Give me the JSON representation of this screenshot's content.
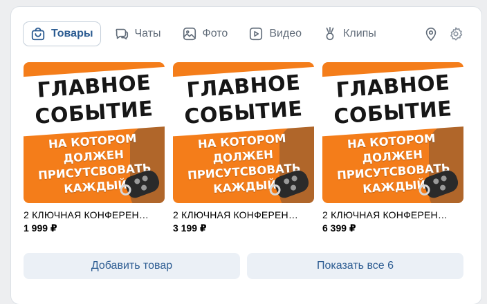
{
  "tabs": [
    {
      "label": "Товары",
      "icon": "bag-icon",
      "active": true
    },
    {
      "label": "Чаты",
      "icon": "chats-icon",
      "active": false
    },
    {
      "label": "Фото",
      "icon": "photo-icon",
      "active": false
    },
    {
      "label": "Видео",
      "icon": "video-icon",
      "active": false
    },
    {
      "label": "Клипы",
      "icon": "clips-icon",
      "active": false
    }
  ],
  "extra_icons": [
    "location-pin-icon",
    "gear-icon"
  ],
  "products": [
    {
      "title": "2 КЛЮЧНАЯ КОНФЕРЕН…",
      "price": "1 999 ₽",
      "image": {
        "line1": "ГЛАВНОЕ",
        "line2": "СОБЫТИЕ",
        "sub": [
          "НА КОТОРОМ",
          "ДОЛЖЕН",
          "ПРИСУТСВОВАТЬ",
          "КАЖДЫЙ"
        ]
      }
    },
    {
      "title": "2 КЛЮЧНАЯ КОНФЕРЕН…",
      "price": "3 199 ₽",
      "image": {
        "line1": "ГЛАВНОЕ",
        "line2": "СОБЫТИЕ",
        "sub": [
          "НА КОТОРОМ",
          "ДОЛЖЕН",
          "ПРИСУТСВОВАТЬ",
          "КАЖДЫЙ"
        ]
      }
    },
    {
      "title": "2 КЛЮЧНАЯ КОНФЕРЕН…",
      "price": "6 399 ₽",
      "image": {
        "line1": "ГЛАВНОЕ",
        "line2": "СОБЫТИЕ",
        "sub": [
          "НА КОТОРОМ",
          "ДОЛЖЕН",
          "ПРИСУТСВОВАТЬ",
          "КАЖДЫЙ"
        ]
      }
    }
  ],
  "actions": {
    "add_product": "Добавить товар",
    "show_all": "Показать все 6"
  },
  "colors": {
    "accent": "#2c5c92",
    "tab_text": "#626d7a",
    "button_bg": "#ebf0f6",
    "product_orange": "#f47d1a"
  }
}
